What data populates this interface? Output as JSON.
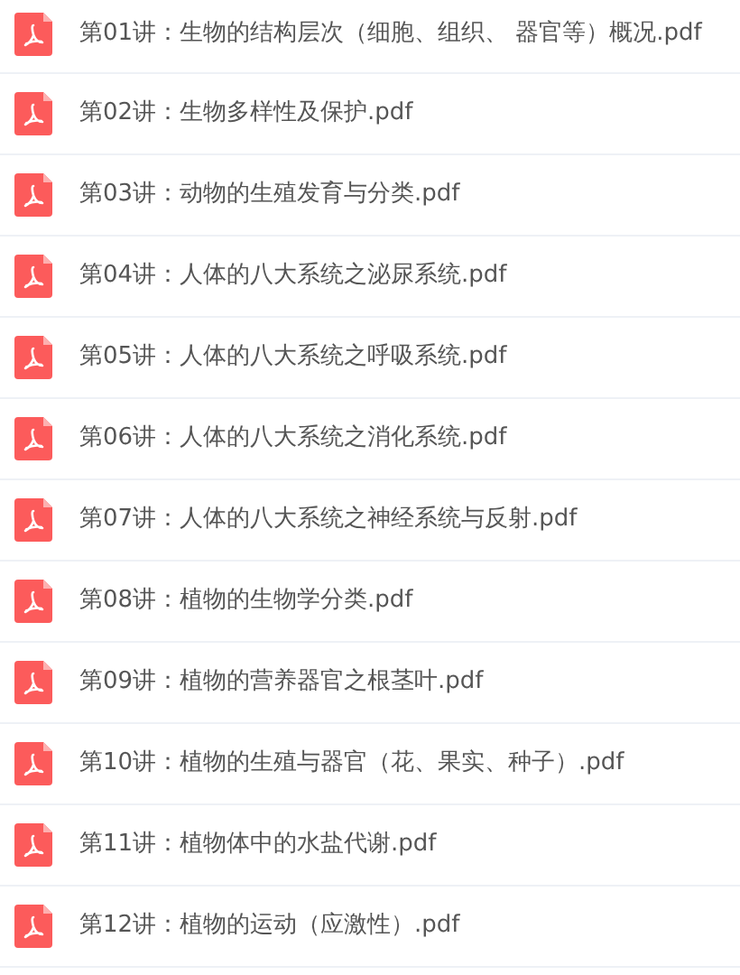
{
  "files": [
    {
      "name": "第01讲：生物的结构层次（细胞、组织、 器官等）概况.pdf"
    },
    {
      "name": "第02讲：生物多样性及保护.pdf"
    },
    {
      "name": "第03讲：动物的生殖发育与分类.pdf"
    },
    {
      "name": "第04讲：人体的八大系统之泌尿系统.pdf"
    },
    {
      "name": "第05讲：人体的八大系统之呼吸系统.pdf"
    },
    {
      "name": "第06讲：人体的八大系统之消化系统.pdf"
    },
    {
      "name": "第07讲：人体的八大系统之神经系统与反射.pdf"
    },
    {
      "name": "第08讲：植物的生物学分类.pdf"
    },
    {
      "name": "第09讲：植物的营养器官之根茎叶.pdf"
    },
    {
      "name": "第10讲：植物的生殖与器官（花、果实、种子）.pdf"
    },
    {
      "name": "第11讲：植物体中的水盐代谢.pdf"
    },
    {
      "name": "第12讲：植物的运动（应激性）.pdf"
    }
  ]
}
